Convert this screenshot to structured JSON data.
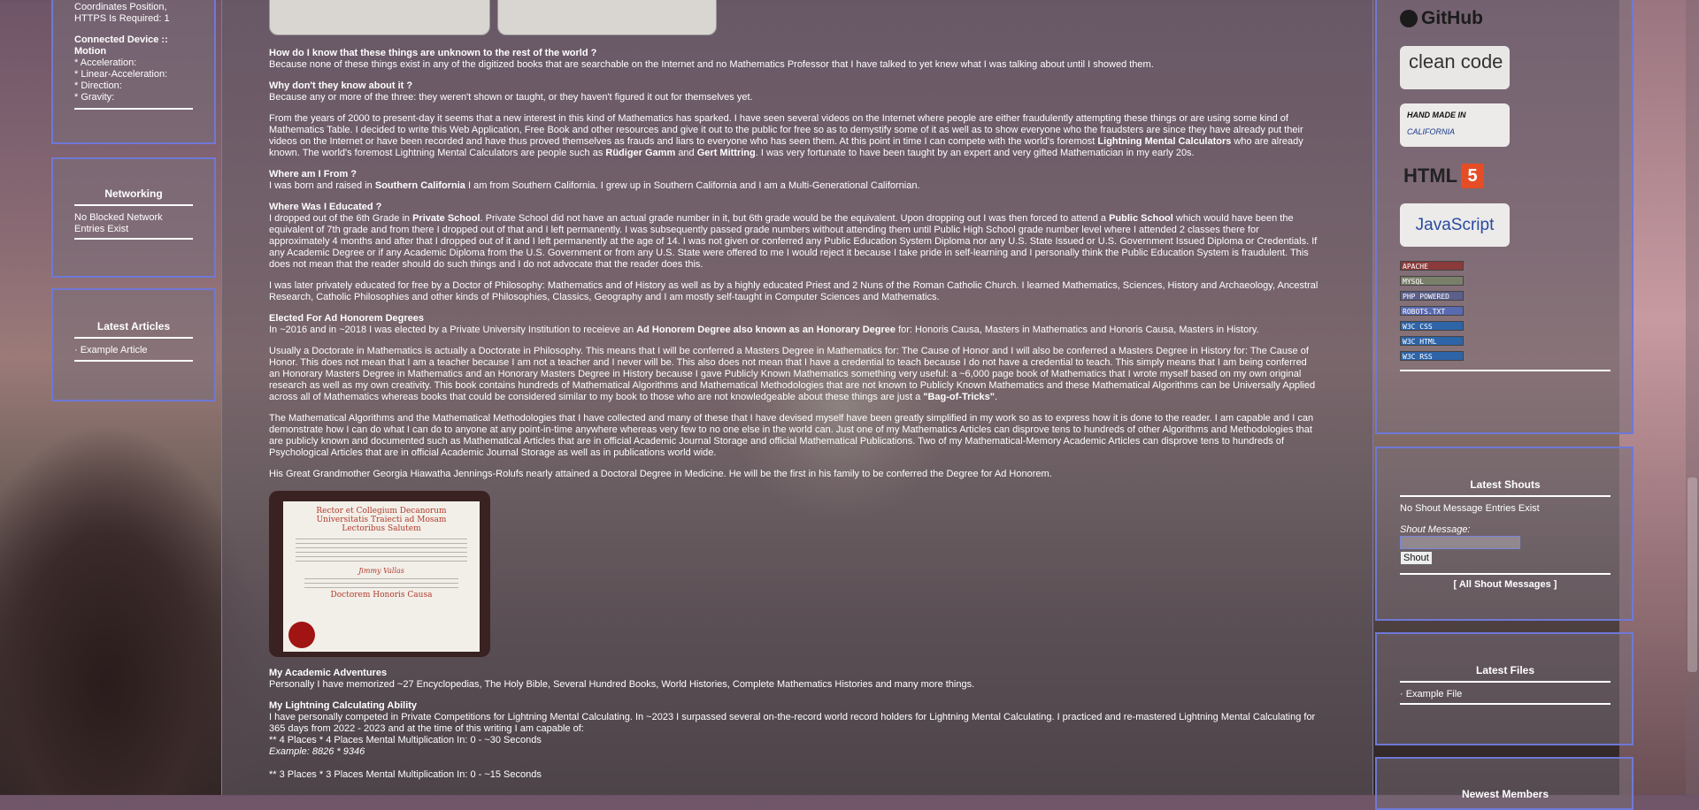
{
  "left": {
    "device_panel": {
      "coords_line": "Coordinates Position,",
      "https_line": "HTTPS Is Required: 1",
      "connected_title": "Connected Device :: Motion",
      "items": [
        "* Acceleration:",
        "* Linear-Acceleration:",
        "* Direction:",
        "* Gravity:"
      ]
    },
    "networking": {
      "title": "Networking",
      "text": "No Blocked Network Entries Exist"
    },
    "latest_articles": {
      "title": "Latest Articles",
      "item": "· Example Article"
    }
  },
  "main": {
    "p1_q": "How do I know that these things are unknown to the rest of the world ?",
    "p1": "Because none of these things exist in any of the digitized books that are searchable on the Internet and no Mathematics Professor that I have talked to yet knew what I was talking about until I showed them.",
    "p2_q": "Why don't they know about it ?",
    "p2": "Because any or more of the three: they weren't shown or taught, or they haven't figured it out for themselves yet.",
    "p3a": "From the years of 2000 to present-day it seems that a new interest in this kind of Mathematics has sparked. I have seen several videos on the Internet where people are either fraudulently attempting these things or are using some kind of Mathematics Table. I decided to write this Web Application, Free Book and other resources and give it out to the public for free so as to demystify some of it as well as to show everyone who the fraudsters are since they have already put their videos on the Internet or have been recorded and have thus proved themselves as frauds and liars to everyone who has seen them. At this point in time I can compete with the world's foremost",
    "p3b": "Lightning Mental Calculators",
    "p3c": "who are already known. The world's foremost Lightning Mental Calculators are people such as",
    "p3d": "Rüdiger Gamm",
    "p3e": "and",
    "p3f": "Gert Mittring",
    "p3g": ". I was very fortunate to have been taught by an expert and very gifted Mathematician in my early 20s.",
    "p4_q": "Where am I From ?",
    "p4a": "I was born and raised in",
    "p4b": "Southern California",
    "p4c": "I am from Southern California. I grew up in Southern California and I am a Multi-Generational Californian.",
    "p5_q": "Where Was I Educated ?",
    "p5a": "I dropped out of the 6th Grade in",
    "p5b": "Private School",
    "p5c": ". Private School did not have an actual grade number in it, but 6th grade would be the equivalent. Upon dropping out I was then forced to attend a",
    "p5d": "Public School",
    "p5e": "which would have been the equivalent of 7th grade and from there I dropped out of that and I left permanently. I was subsequently passed grade numbers without attending them until Public High School grade number level where I attended 2 classes there for approximately 4 months and after that I dropped out of it and I left permanently at the age of 14. I was not given or conferred any Public Education System Diploma nor any U.S. State Issued or U.S. Government Issued Diploma or Credentials. If any Academic Degree or if any Academic Diploma from the U.S. Government or from any U.S. State were offered to me I would reject it because I take pride in self-learning and I personally think the Public Education System is fraudulent. This does not mean that the reader should do such things and I do not advocate that the reader does this.",
    "p6": "I was later privately educated for free by a Doctor of Philosophy: Mathematics and of History as well as by a highly educated Priest and 2 Nuns of the Roman Catholic Church. I learned Mathematics, Sciences, History and Archaeology, Ancestral Research, Catholic Philosophies and other kinds of Philosophies, Classics, Geography and I am mostly self-taught in Computer Sciences and Mathematics.",
    "p7_q": "Elected For Ad Honorem Degrees",
    "p7a": "In ~2016 and in ~2018 I was elected by a Private University Institution to receieve an",
    "p7b": "Ad Honorem Degree also known as an Honorary Degree",
    "p7c": "for: Honoris Causa, Masters in Mathematics and Honoris Causa, Masters in History.",
    "p8a": "Usually a Doctorate in Mathematics is actually a Doctorate in Philosophy. This means that I will be conferred a Masters Degree in Mathematics for: The Cause of Honor and I will also be conferred a Masters Degree in History for: The Cause of Honor. This does not mean that I am a teacher because I am not a teacher and I never will be. This also does not mean that I have a credential to teach because I do not have a credential to teach. This simply means that I am being conferred an Honorary Masters Degree in Mathematics and an Honorary Masters Degree in History because I gave Publicly Known Mathematics something very useful: a ~6,000 page book of Mathematics that I wrote myself based on my own original research as well as my own creativity. This book contains hundreds of Mathematical Algorithms and Mathematical Methodologies that are not known to Publicly Known Mathematics and these Mathematical Algorithms can be Universally Applied across all of Mathematics whereas books that could be considered similar to my book to those who are not knowledgeable about these things are just a",
    "p8b": "\"Bag-of-Tricks\"",
    "p8c": ".",
    "p9": "The Mathematical Algorithms and the Mathematical Methodologies that I have collected and many of these that I have devised myself have been greatly simplified in my work so as to express how it is done to the reader. I am capable and I can demonstrate how I can do what I can do to anyone at any point-in-time anywhere whereas very few to no one else in the world can. Just one of my Mathematics Articles can disprove tens to hundreds of other Algorithms and Methodologies that are publicly known and documented such as Mathematical Articles that are in official Academic Journal Storage and official Mathematical Publications. Two of my Mathematical-Memory Academic Articles can disprove tens to hundreds of Psychological Articles that are in official Academic Journal Storage as well as in publications world wide.",
    "p10": "His Great Grandmother Georgia Hiawatha Jennings-Rolufs nearly attained a Doctoral Degree in Medicine. He will be the first in his family to be conferred the Degree for Ad Honorem.",
    "diploma": {
      "l1": "Rector et Collegium Decanorum",
      "l2": "Universitatis Traiecti ad Mosam",
      "l3": "Lectoribus Salutem",
      "l4": "Jimmy Vallas",
      "l5": "Doctorem Honoris Causa"
    },
    "p11_q": "My Academic Adventures",
    "p11": "Personally I have memorized ~27 Encyclopedias, The Holy Bible, Several Hundred Books, World Histories, Complete Mathematics Histories and many more things.",
    "p12_q": "My Lightning Calculating Ability",
    "p12": "I have personally competed in Private Competitions for Lightning Mental Calculating. In ~2023 I surpassed several on-the-record world record holders for Lightning Mental Calculating. I practiced and re-mastered Lightning Mental Calculating for 365 days from 2022 - 2023 and at the time of this writing I am capable of:",
    "p12_l1": "** 4 Places * 4 Places Mental Multiplication In: 0 - ~30 Seconds",
    "p12_l2": "Example: 8826 * 9346",
    "p12_l3": "** 3 Places * 3 Places Mental Multiplication In: 0 - ~15 Seconds"
  },
  "right": {
    "github": "GitHub",
    "clean_code": "clean code",
    "hand_made_1": "HAND MADE IN",
    "hand_made_2": "CALIFORNIA",
    "html5": "HTML",
    "html5_num": "5",
    "javascript": "JavaScript",
    "badges": [
      "APACHE",
      "MYSQL",
      "PHP POWERED",
      "ROBOTS.TXT",
      "W3C CSS",
      "W3C HTML",
      "W3C RSS"
    ],
    "shouts": {
      "title": "Latest Shouts",
      "empty": "No Shout Message Entries Exist",
      "label": "Shout Message:",
      "button": "Shout",
      "all": "[ All Shout Messages ]"
    },
    "files": {
      "title": "Latest Files",
      "item": "· Example File"
    },
    "members": {
      "title": "Newest Members"
    }
  },
  "colors": {
    "panel_border": "#6f78d6",
    "text": "#ffffff"
  }
}
